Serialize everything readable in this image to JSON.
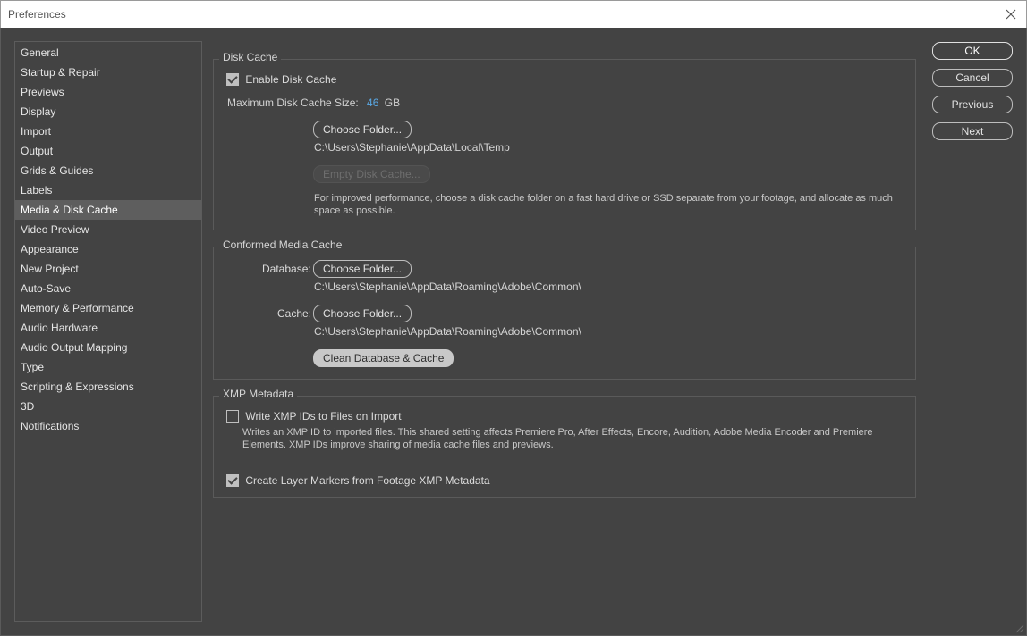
{
  "window": {
    "title": "Preferences"
  },
  "sidebar": {
    "items": [
      {
        "label": "General"
      },
      {
        "label": "Startup & Repair"
      },
      {
        "label": "Previews"
      },
      {
        "label": "Display"
      },
      {
        "label": "Import"
      },
      {
        "label": "Output"
      },
      {
        "label": "Grids & Guides"
      },
      {
        "label": "Labels"
      },
      {
        "label": "Media & Disk Cache",
        "selected": true
      },
      {
        "label": "Video Preview"
      },
      {
        "label": "Appearance"
      },
      {
        "label": "New Project"
      },
      {
        "label": "Auto-Save"
      },
      {
        "label": "Memory & Performance"
      },
      {
        "label": "Audio Hardware"
      },
      {
        "label": "Audio Output Mapping"
      },
      {
        "label": "Type"
      },
      {
        "label": "Scripting & Expressions"
      },
      {
        "label": "3D"
      },
      {
        "label": "Notifications"
      }
    ]
  },
  "disk_cache": {
    "title": "Disk Cache",
    "enable_label": "Enable Disk Cache",
    "enable_checked": true,
    "max_size_label": "Maximum Disk Cache Size:",
    "max_size_value": "46",
    "max_size_unit": "GB",
    "choose_folder": "Choose Folder...",
    "path": "C:\\Users\\Stephanie\\AppData\\Local\\Temp",
    "empty_button": "Empty Disk Cache...",
    "description": "For improved performance, choose a disk cache folder on a fast hard drive or SSD separate from your footage, and allocate as much space as possible."
  },
  "conformed": {
    "title": "Conformed Media Cache",
    "database_label": "Database:",
    "database_button": "Choose Folder...",
    "database_path": "C:\\Users\\Stephanie\\AppData\\Roaming\\Adobe\\Common\\",
    "cache_label": "Cache:",
    "cache_button": "Choose Folder...",
    "cache_path": "C:\\Users\\Stephanie\\AppData\\Roaming\\Adobe\\Common\\",
    "clean_button": "Clean Database & Cache"
  },
  "xmp": {
    "title": "XMP Metadata",
    "write_label": "Write XMP IDs to Files on Import",
    "write_checked": false,
    "write_description": "Writes an XMP ID to imported files. This shared setting affects Premiere Pro, After Effects, Encore, Audition, Adobe Media Encoder and Premiere Elements. XMP IDs improve sharing of media cache files and previews.",
    "markers_label": "Create Layer Markers from Footage XMP Metadata",
    "markers_checked": true
  },
  "buttons": {
    "ok": "OK",
    "cancel": "Cancel",
    "previous": "Previous",
    "next": "Next"
  },
  "colors": {
    "background": "#434343",
    "accent": "#5aa9e6",
    "selected_item": "#5e5e5e"
  }
}
